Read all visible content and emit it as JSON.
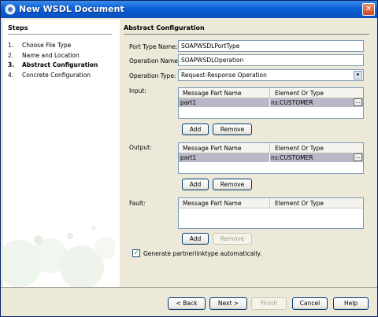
{
  "window": {
    "title": "New WSDL Document",
    "close_glyph": "✕",
    "colors": {
      "titlebar": "#0b5fd6",
      "panel": "#ece9d8",
      "selected_row": "#b8b8c8"
    }
  },
  "steps": {
    "heading": "Steps",
    "items": [
      {
        "num": "1.",
        "label": "Choose File Type",
        "active": false
      },
      {
        "num": "2.",
        "label": "Name and Location",
        "active": false
      },
      {
        "num": "3.",
        "label": "Abstract Configuration",
        "active": true
      },
      {
        "num": "4.",
        "label": "Concrete Configuration",
        "active": false
      }
    ]
  },
  "main": {
    "heading": "Abstract Configuration",
    "port_type": {
      "label": "Port Type Name:",
      "value": "SOAPWSDLPortType"
    },
    "operation": {
      "label": "Operation Name:",
      "value": "SOAPWSDLOperation"
    },
    "operation_type": {
      "label": "Operation Type:",
      "value": "Request-Response Operation",
      "arrow": "▾"
    },
    "input": {
      "label": "Input:",
      "columns": [
        "Message Part Name",
        "Element Or Type"
      ],
      "row": {
        "part": "part1",
        "type": "ns:CUSTOMER",
        "ellipsis": "..."
      },
      "add_label": "Add",
      "remove_label": "Remove"
    },
    "output": {
      "label": "Output:",
      "columns": [
        "Message Part Name",
        "Element Or Type"
      ],
      "row": {
        "part": "part1",
        "type": "ns:CUSTOMER",
        "ellipsis": "..."
      },
      "add_label": "Add",
      "remove_label": "Remove"
    },
    "fault": {
      "label": "Fault:",
      "columns": [
        "Message Part Name",
        "Element Or Type"
      ],
      "add_label": "Add",
      "remove_label": "Remove"
    },
    "partnerlink": {
      "label": "Generate partnerlinktype automatically.",
      "checked": true,
      "check_glyph": "✓"
    }
  },
  "footer": {
    "back": "< Back",
    "next": "Next >",
    "finish": "Finish",
    "cancel": "Cancel",
    "help": "Help"
  }
}
